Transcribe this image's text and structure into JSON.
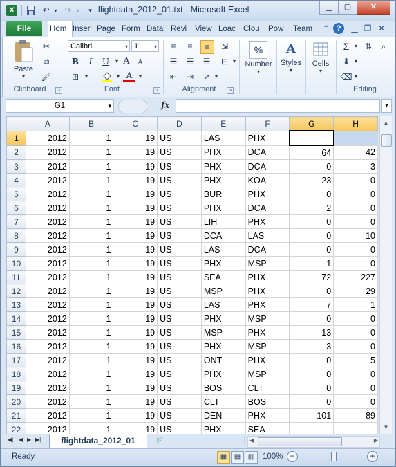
{
  "window": {
    "title": "flightdata_2012_01.txt  -  Microsoft Excel",
    "controls": {
      "minimize": "▁",
      "maximize": "▢",
      "close": "✕"
    }
  },
  "quick_access": {
    "save_icon": "save-icon",
    "undo_icon": "undo-icon",
    "redo_icon": "redo-icon"
  },
  "ribbon_tabs": {
    "file": "File",
    "tabs": [
      "Hom",
      "Inser",
      "Page",
      "Form",
      "Data",
      "Revi",
      "View",
      "Loac",
      "Clou",
      "Pow",
      "Team"
    ],
    "active_index": 0
  },
  "ribbon": {
    "clipboard": {
      "label": "Clipboard",
      "paste": "Paste"
    },
    "font": {
      "label": "Font",
      "name": "Calibri",
      "size": "11",
      "bold": "B",
      "italic": "I",
      "underline": "U",
      "grow": "A",
      "shrink": "A",
      "font_color": "A"
    },
    "alignment": {
      "label": "Alignment"
    },
    "number": {
      "label": "Number",
      "symbol": "%"
    },
    "styles": {
      "label": "Styles",
      "symbol": "A"
    },
    "cells": {
      "label": "Cells"
    },
    "editing": {
      "label": "Editing",
      "sum": "Σ"
    }
  },
  "formula_bar": {
    "name_box": "G1",
    "fx": "fx",
    "formula": ""
  },
  "grid": {
    "columns": [
      "A",
      "B",
      "C",
      "D",
      "E",
      "F",
      "G",
      "H"
    ],
    "selected_columns": [
      "G",
      "H"
    ],
    "active_cell": "G1",
    "rows": [
      {
        "n": "1",
        "c": [
          "2012",
          "1",
          "19",
          "US",
          "LAS",
          "PHX",
          "",
          ""
        ]
      },
      {
        "n": "2",
        "c": [
          "2012",
          "1",
          "19",
          "US",
          "PHX",
          "DCA",
          "64",
          "42"
        ]
      },
      {
        "n": "3",
        "c": [
          "2012",
          "1",
          "19",
          "US",
          "PHX",
          "DCA",
          "0",
          "3"
        ]
      },
      {
        "n": "4",
        "c": [
          "2012",
          "1",
          "19",
          "US",
          "PHX",
          "KOA",
          "23",
          "0"
        ]
      },
      {
        "n": "5",
        "c": [
          "2012",
          "1",
          "19",
          "US",
          "BUR",
          "PHX",
          "0",
          "0"
        ]
      },
      {
        "n": "6",
        "c": [
          "2012",
          "1",
          "19",
          "US",
          "PHX",
          "DCA",
          "2",
          "0"
        ]
      },
      {
        "n": "7",
        "c": [
          "2012",
          "1",
          "19",
          "US",
          "LIH",
          "PHX",
          "0",
          "0"
        ]
      },
      {
        "n": "8",
        "c": [
          "2012",
          "1",
          "19",
          "US",
          "DCA",
          "LAS",
          "0",
          "10"
        ]
      },
      {
        "n": "9",
        "c": [
          "2012",
          "1",
          "19",
          "US",
          "LAS",
          "DCA",
          "0",
          "0"
        ]
      },
      {
        "n": "10",
        "c": [
          "2012",
          "1",
          "19",
          "US",
          "PHX",
          "MSP",
          "1",
          "0"
        ]
      },
      {
        "n": "11",
        "c": [
          "2012",
          "1",
          "19",
          "US",
          "SEA",
          "PHX",
          "72",
          "227"
        ]
      },
      {
        "n": "12",
        "c": [
          "2012",
          "1",
          "19",
          "US",
          "MSP",
          "PHX",
          "0",
          "29"
        ]
      },
      {
        "n": "13",
        "c": [
          "2012",
          "1",
          "19",
          "US",
          "LAS",
          "PHX",
          "7",
          "1"
        ]
      },
      {
        "n": "14",
        "c": [
          "2012",
          "1",
          "19",
          "US",
          "PHX",
          "MSP",
          "0",
          "0"
        ]
      },
      {
        "n": "15",
        "c": [
          "2012",
          "1",
          "19",
          "US",
          "MSP",
          "PHX",
          "13",
          "0"
        ]
      },
      {
        "n": "16",
        "c": [
          "2012",
          "1",
          "19",
          "US",
          "PHX",
          "MSP",
          "3",
          "0"
        ]
      },
      {
        "n": "17",
        "c": [
          "2012",
          "1",
          "19",
          "US",
          "ONT",
          "PHX",
          "0",
          "5"
        ]
      },
      {
        "n": "18",
        "c": [
          "2012",
          "1",
          "19",
          "US",
          "PHX",
          "MSP",
          "0",
          "0"
        ]
      },
      {
        "n": "19",
        "c": [
          "2012",
          "1",
          "19",
          "US",
          "BOS",
          "CLT",
          "0",
          "0"
        ]
      },
      {
        "n": "20",
        "c": [
          "2012",
          "1",
          "19",
          "US",
          "CLT",
          "BOS",
          "0",
          "0"
        ]
      },
      {
        "n": "21",
        "c": [
          "2012",
          "1",
          "19",
          "US",
          "DEN",
          "PHX",
          "101",
          "89"
        ]
      },
      {
        "n": "22",
        "c": [
          "2012",
          "1",
          "19",
          "US",
          "PHX",
          "SEA",
          "",
          ""
        ]
      }
    ]
  },
  "sheet_tabs": {
    "active": "flightdata_2012_01"
  },
  "status_bar": {
    "ready": "Ready",
    "zoom": "100%",
    "zoom_out": "−",
    "zoom_in": "+"
  }
}
